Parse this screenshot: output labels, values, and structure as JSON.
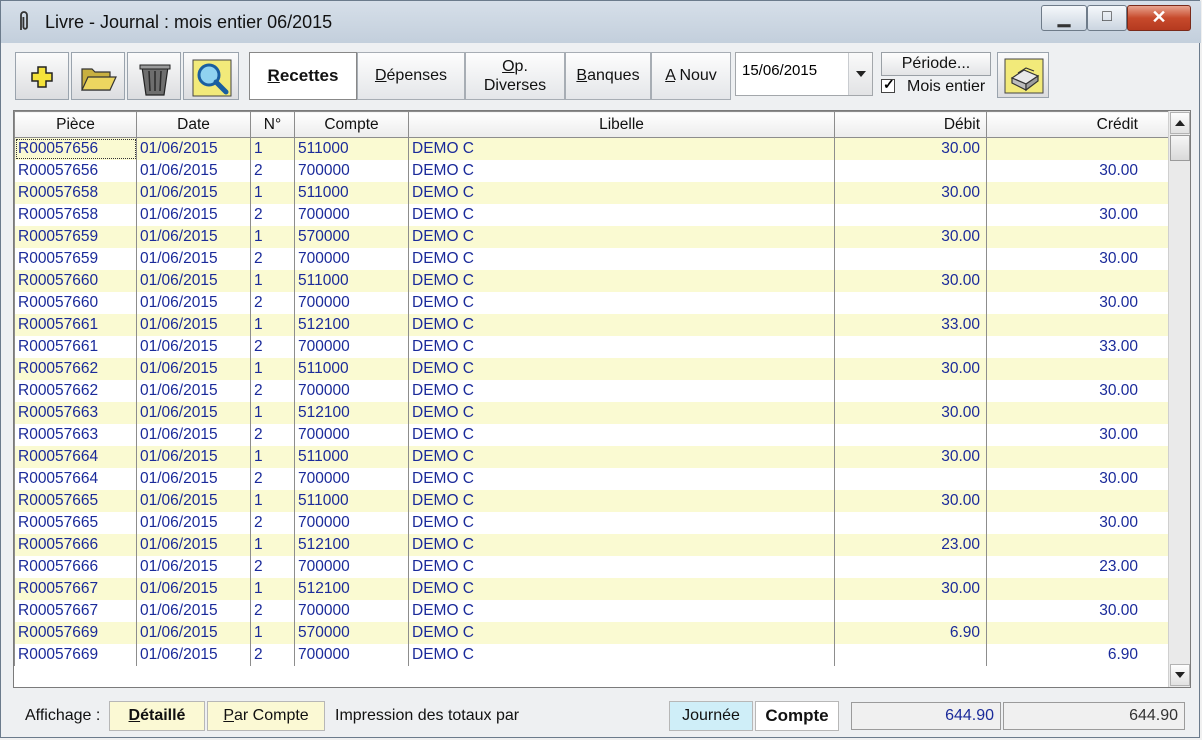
{
  "window": {
    "title": "Livre - Journal : mois entier 06/2015"
  },
  "toolbar": {
    "tabs": [
      {
        "label": "Recettes",
        "underline": "R",
        "rest": "ecettes",
        "active": true
      },
      {
        "label": "Dépenses",
        "underline": "D",
        "rest": "épenses"
      },
      {
        "line1_ul": "O",
        "line1_rest": "p.",
        "line2": "Diverses"
      },
      {
        "label": "Banques",
        "underline": "B",
        "rest": "anques"
      },
      {
        "label": "A Nouv",
        "underline": "A",
        "rest": " Nouv"
      }
    ],
    "date_value": "15/06/2015",
    "periode_label": "Période...",
    "mois_entier_label": "Mois entier",
    "mois_entier_checked": true
  },
  "table": {
    "headers": [
      "Pièce",
      "Date",
      "N°",
      "Compte",
      "Libelle",
      "Débit",
      "Crédit"
    ],
    "rows": [
      [
        "R00057656",
        "01/06/2015",
        "1",
        "511000",
        "DEMO C",
        "30.00",
        ""
      ],
      [
        "R00057656",
        "01/06/2015",
        "2",
        "700000",
        "DEMO C",
        "",
        "30.00"
      ],
      [
        "R00057658",
        "01/06/2015",
        "1",
        "511000",
        "DEMO C",
        "30.00",
        ""
      ],
      [
        "R00057658",
        "01/06/2015",
        "2",
        "700000",
        "DEMO C",
        "",
        "30.00"
      ],
      [
        "R00057659",
        "01/06/2015",
        "1",
        "570000",
        "DEMO C",
        "30.00",
        ""
      ],
      [
        "R00057659",
        "01/06/2015",
        "2",
        "700000",
        "DEMO C",
        "",
        "30.00"
      ],
      [
        "R00057660",
        "01/06/2015",
        "1",
        "511000",
        "DEMO C",
        "30.00",
        ""
      ],
      [
        "R00057660",
        "01/06/2015",
        "2",
        "700000",
        "DEMO C",
        "",
        "30.00"
      ],
      [
        "R00057661",
        "01/06/2015",
        "1",
        "512100",
        "DEMO C",
        "33.00",
        ""
      ],
      [
        "R00057661",
        "01/06/2015",
        "2",
        "700000",
        "DEMO C",
        "",
        "33.00"
      ],
      [
        "R00057662",
        "01/06/2015",
        "1",
        "511000",
        "DEMO C",
        "30.00",
        ""
      ],
      [
        "R00057662",
        "01/06/2015",
        "2",
        "700000",
        "DEMO C",
        "",
        "30.00"
      ],
      [
        "R00057663",
        "01/06/2015",
        "1",
        "512100",
        "DEMO C",
        "30.00",
        ""
      ],
      [
        "R00057663",
        "01/06/2015",
        "2",
        "700000",
        "DEMO C",
        "",
        "30.00"
      ],
      [
        "R00057664",
        "01/06/2015",
        "1",
        "511000",
        "DEMO C",
        "30.00",
        ""
      ],
      [
        "R00057664",
        "01/06/2015",
        "2",
        "700000",
        "DEMO C",
        "",
        "30.00"
      ],
      [
        "R00057665",
        "01/06/2015",
        "1",
        "511000",
        "DEMO C",
        "30.00",
        ""
      ],
      [
        "R00057665",
        "01/06/2015",
        "2",
        "700000",
        "DEMO C",
        "",
        "30.00"
      ],
      [
        "R00057666",
        "01/06/2015",
        "1",
        "512100",
        "DEMO C",
        "23.00",
        ""
      ],
      [
        "R00057666",
        "01/06/2015",
        "2",
        "700000",
        "DEMO C",
        "",
        "23.00"
      ],
      [
        "R00057667",
        "01/06/2015",
        "1",
        "512100",
        "DEMO C",
        "30.00",
        ""
      ],
      [
        "R00057667",
        "01/06/2015",
        "2",
        "700000",
        "DEMO C",
        "",
        "30.00"
      ],
      [
        "R00057669",
        "01/06/2015",
        "1",
        "570000",
        "DEMO C",
        "6.90",
        ""
      ],
      [
        "R00057669",
        "01/06/2015",
        "2",
        "700000",
        "DEMO C",
        "",
        "6.90"
      ]
    ]
  },
  "status": {
    "affichage_label": "Affichage :",
    "detaille_ul": "D",
    "detaille_rest": "étaillé",
    "parcompte_ul": "P",
    "parcompte_rest": "ar Compte",
    "impression_label": "Impression des totaux par",
    "journee_label": "Journée",
    "compte_label": "Compte",
    "total_debit": "644.90",
    "total_credit": "644.90"
  },
  "colors": {
    "row_alt": "#fafad2",
    "text_blue": "#1a2a9a",
    "journee_bg": "#cfeef8"
  },
  "icons": [
    "paperclip-icon",
    "plus-icon",
    "open-folder-icon",
    "trash-bin-icon",
    "magnifier-icon",
    "printer-icon",
    "minimize-icon",
    "maximize-icon",
    "close-icon"
  ]
}
